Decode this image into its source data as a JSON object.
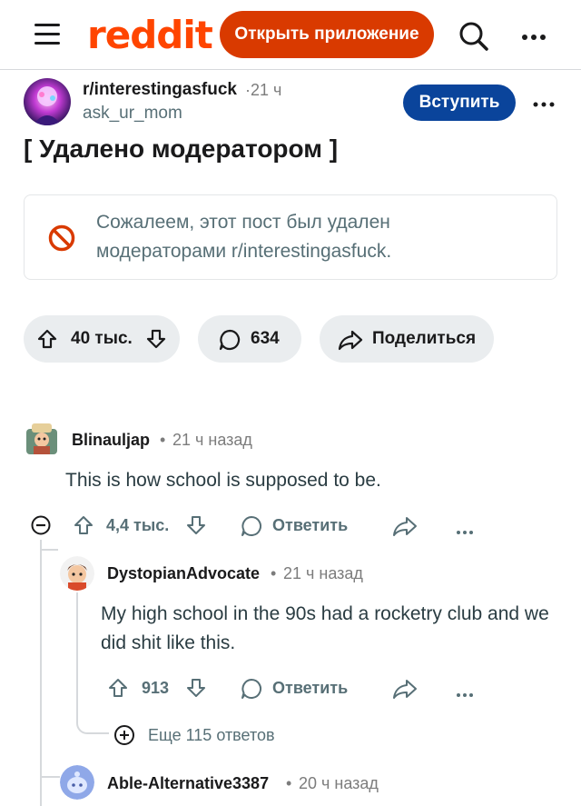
{
  "header": {
    "logo_text": "reddit",
    "open_app_label": "Открыть приложение",
    "brand_color": "#ff4500",
    "icons": [
      "hamburger-icon",
      "search-icon",
      "more-icon"
    ]
  },
  "post": {
    "subreddit": "r/interestingasfuck",
    "time": "·21 ч",
    "author": "ask_ur_mom",
    "join_label": "Вступить",
    "title": "[ Удалено модератором ]",
    "removed_notice": "Сожалеем, этот пост был удален модераторами r/interestingasfuck.",
    "upvotes": "40 тыс.",
    "comments_count": "634",
    "share_label": "Поделиться"
  },
  "comments": [
    {
      "username": "Blinauljap",
      "time": "21 ч назад",
      "body": "This is how school is supposed to be.",
      "score": "4,4 тыс.",
      "reply_label": "Ответить"
    },
    {
      "username": "DystopianAdvocate",
      "time": "21 ч назад",
      "body": "My high school in the 90s had a rocketry club and we did shit like this.",
      "score": "913",
      "reply_label": "Ответить",
      "more_replies_label": "Еще 115 ответов"
    },
    {
      "username": "Able-Alternative3387",
      "time": "20 ч назад"
    }
  ],
  "separator_dot": "•"
}
